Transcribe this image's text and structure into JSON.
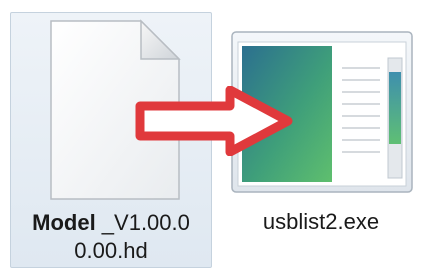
{
  "files": [
    {
      "icon": "document-icon",
      "name_bold": "Model",
      "name_rest_line1": " _V1.00.0",
      "name_line2": "0.00.hd",
      "selected": true
    },
    {
      "icon": "exe-window-icon",
      "name": "usblist2.exe",
      "selected": false
    }
  ],
  "arrow": {
    "icon": "right-arrow-icon",
    "color": "#e0393c"
  },
  "colors": {
    "selection_bg": "#e7eef5",
    "selection_border": "#c5d2de",
    "arrow_red": "#e0393c",
    "exe_green": "#4fae6e",
    "exe_teal": "#2f7f86"
  }
}
